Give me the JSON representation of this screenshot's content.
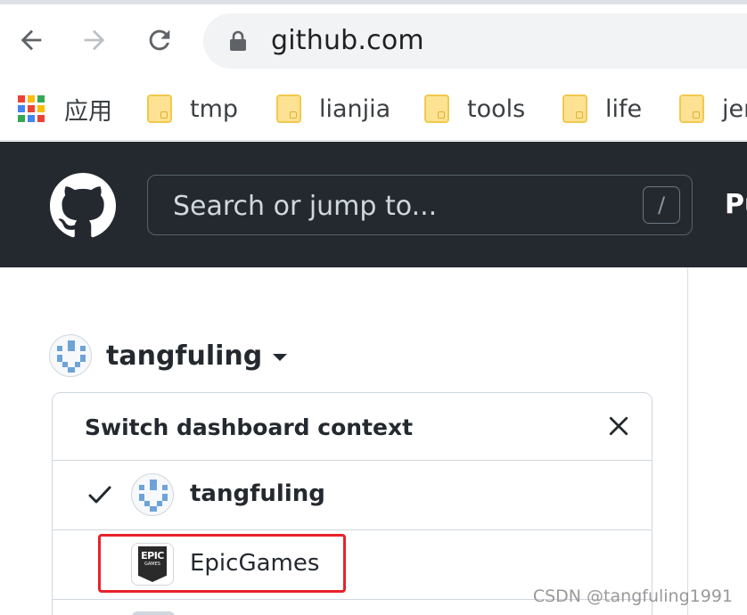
{
  "browser": {
    "url": "github.com",
    "back_icon": "back-arrow-icon",
    "forward_icon": "forward-arrow-icon",
    "reload_icon": "reload-icon",
    "lock_icon": "lock-icon"
  },
  "bookmarks": {
    "apps_label": "应用",
    "items": [
      {
        "label": "tmp"
      },
      {
        "label": "lianjia"
      },
      {
        "label": "tools"
      },
      {
        "label": "life"
      },
      {
        "label": "jen"
      }
    ]
  },
  "github_header": {
    "search_placeholder": "Search or jump to...",
    "search_shortcut": "/",
    "nav_partial": "Pu"
  },
  "context_switcher": {
    "username": "tangfuling"
  },
  "dropdown": {
    "title": "Switch dashboard context",
    "items": [
      {
        "label": "tangfuling",
        "selected": true
      },
      {
        "label": "EpicGames",
        "selected": false,
        "logo_line1": "EPIC",
        "logo_line2": "GAMES"
      }
    ]
  },
  "watermark": "CSDN @tangfuling1991",
  "colors": {
    "header_bg": "#24292f",
    "highlight": "#e8212a",
    "border": "#d0d7de"
  }
}
